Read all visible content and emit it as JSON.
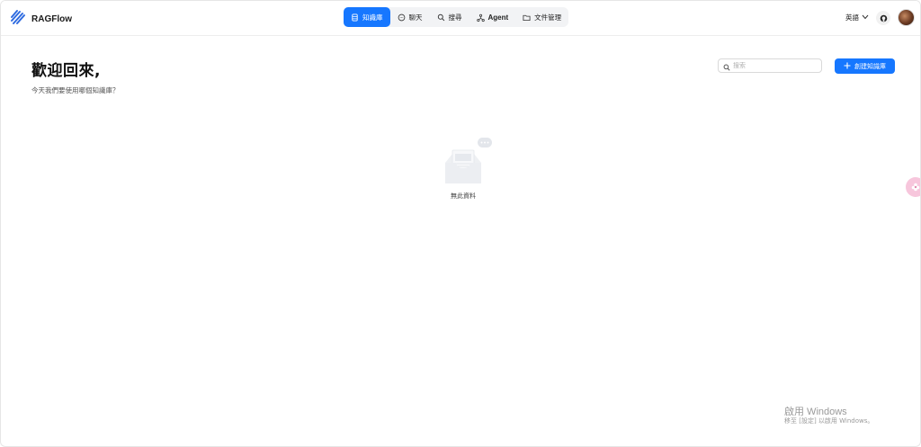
{
  "app": {
    "name": "RAGFlow"
  },
  "nav": {
    "items": [
      {
        "label": "知識庫",
        "icon": "database-icon",
        "active": true
      },
      {
        "label": "聊天",
        "icon": "chat-icon",
        "active": false
      },
      {
        "label": "搜尋",
        "icon": "search-icon",
        "active": false
      },
      {
        "label": "Agent",
        "icon": "agent-icon",
        "active": false
      },
      {
        "label": "文件管理",
        "icon": "folder-icon",
        "active": false
      }
    ]
  },
  "header": {
    "language": "英語"
  },
  "main": {
    "welcome": "歡迎回來,",
    "subtitle": "今天我們要使用哪個知識庫？",
    "search_placeholder": "搜索",
    "create_button": "創建知識庫",
    "empty_text": "無此資料"
  },
  "watermark": {
    "title": "啟用 Windows",
    "subtitle": "移至 [設定] 以啟用 Windows。"
  },
  "colors": {
    "accent": "#1677ff",
    "nav_bg": "#f2f3f5",
    "float_button": "#f7c6dc"
  }
}
